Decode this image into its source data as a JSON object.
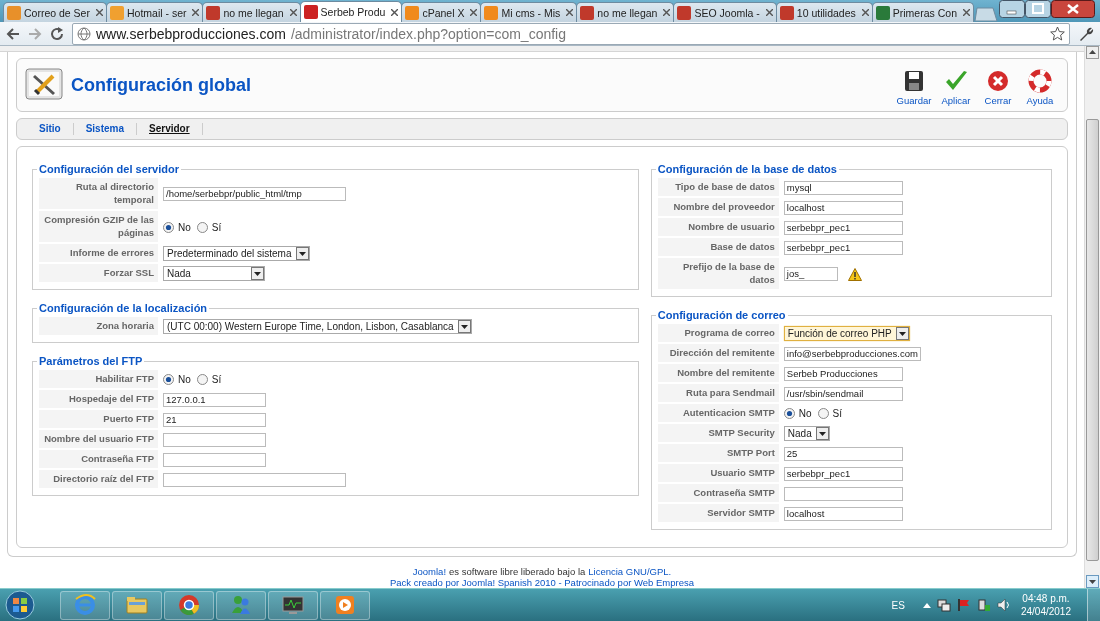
{
  "browser": {
    "tabs": [
      {
        "title": "Correo de Ser",
        "selected": false,
        "color": "#e8902a"
      },
      {
        "title": "Hotmail - ser",
        "selected": false,
        "color": "#f0a030"
      },
      {
        "title": "no me llegan",
        "selected": false,
        "color": "#c0392b"
      },
      {
        "title": "Serbeb Produ",
        "selected": true,
        "color": "#cc2222"
      },
      {
        "title": "cPanel X",
        "selected": false,
        "color": "#f08a1c"
      },
      {
        "title": "Mi cms - Mis",
        "selected": false,
        "color": "#f08a1c"
      },
      {
        "title": "no me llegan",
        "selected": false,
        "color": "#c0392b"
      },
      {
        "title": "SEO Joomla -",
        "selected": false,
        "color": "#c0392b"
      },
      {
        "title": "10 utilidades",
        "selected": false,
        "color": "#c0392b"
      },
      {
        "title": "Primeras Con",
        "selected": false,
        "color": "#2a7a3a"
      }
    ],
    "address": {
      "host": "www.serbebproducciones.com",
      "path": "/administrator/index.php?option=com_config"
    }
  },
  "header": {
    "title": "Configuración global",
    "toolbar": [
      {
        "label": "Guardar",
        "kind": "save"
      },
      {
        "label": "Aplicar",
        "kind": "apply"
      },
      {
        "label": "Cerrar",
        "kind": "close"
      },
      {
        "label": "Ayuda",
        "kind": "help"
      }
    ]
  },
  "submenu": [
    {
      "label": "Sitio",
      "selected": false
    },
    {
      "label": "Sistema",
      "selected": false
    },
    {
      "label": "Servidor",
      "selected": true
    }
  ],
  "left_column": [
    {
      "legend": "Configuración del servidor",
      "rows": [
        {
          "label": "Ruta al directorio temporal",
          "kind": "text",
          "value": "/home/serbebpr/public_html/tmp"
        },
        {
          "label": "Compresión GZIP de las páginas",
          "kind": "radio",
          "options": [
            {
              "label": "No",
              "selected": true
            },
            {
              "label": "Sí",
              "selected": false
            }
          ]
        },
        {
          "label": "Informe de errores",
          "kind": "select",
          "value": "Predeterminado del sistema",
          "focused": false
        },
        {
          "label": "Forzar SSL",
          "kind": "select",
          "value": "Nada",
          "focused": false
        }
      ]
    },
    {
      "legend": "Configuración de la localización",
      "rows": [
        {
          "label": "Zona horaria",
          "kind": "select",
          "value": "(UTC 00:00) Western Europe Time, London, Lisbon, Casablanca",
          "focused": false
        }
      ]
    },
    {
      "legend": "Parámetros del FTP",
      "rows": [
        {
          "label": "Habilitar FTP",
          "kind": "radio",
          "options": [
            {
              "label": "No",
              "selected": true
            },
            {
              "label": "Sí",
              "selected": false
            }
          ]
        },
        {
          "label": "Hospedaje del FTP",
          "kind": "text",
          "value": "127.0.0.1"
        },
        {
          "label": "Puerto FTP",
          "kind": "text",
          "value": "21"
        },
        {
          "label": "Nombre del usuario FTP",
          "kind": "text"
        },
        {
          "label": "Contraseña FTP",
          "kind": "text"
        },
        {
          "label": "Directorio raíz del FTP",
          "kind": "text"
        }
      ]
    }
  ],
  "right_column": [
    {
      "legend": "Configuración de la base de datos",
      "rows": [
        {
          "label": "Tipo de base de datos",
          "kind": "text",
          "value": "mysql"
        },
        {
          "label": "Nombre del proveedor",
          "kind": "text",
          "value": "localhost"
        },
        {
          "label": "Nombre de usuario",
          "kind": "text",
          "value": "serbebpr_pec1"
        },
        {
          "label": "Base de datos",
          "kind": "text",
          "value": "serbebpr_pec1"
        },
        {
          "label": "Prefijo de la base de datos",
          "kind": "text",
          "value": "jos_",
          "warning": true
        }
      ]
    },
    {
      "legend": "Configuración de correo",
      "rows": [
        {
          "label": "Programa de correo",
          "kind": "select",
          "value": "Función de correo PHP",
          "focused": true
        },
        {
          "label": "Dirección del remitente",
          "kind": "text",
          "value": "info@serbebproducciones.com"
        },
        {
          "label": "Nombre del remitente",
          "kind": "text",
          "value": "Serbeb Producciones"
        },
        {
          "label": "Ruta para Sendmail",
          "kind": "text",
          "value": "/usr/sbin/sendmail"
        },
        {
          "label": "Autenticacion SMTP",
          "kind": "radio",
          "options": [
            {
              "label": "No",
              "selected": true
            },
            {
              "label": "Sí",
              "selected": false
            }
          ]
        },
        {
          "label": "SMTP Security",
          "kind": "select",
          "value": "Nada",
          "focused": false
        },
        {
          "label": "SMTP Port",
          "kind": "text",
          "value": "25"
        },
        {
          "label": "Usuario SMTP",
          "kind": "text",
          "value": "serbebpr_pec1"
        },
        {
          "label": "Contraseña SMTP",
          "kind": "text"
        },
        {
          "label": "Servidor SMTP",
          "kind": "text",
          "value": "localhost"
        }
      ]
    }
  ],
  "footer": {
    "lines": [
      [
        {
          "text": "Joomla!",
          "kind": "link"
        },
        {
          "text": "es software libre liberado bajo la",
          "kind": "text"
        },
        {
          "text": "Licencia GNU/GPL.",
          "kind": "link"
        }
      ],
      [
        {
          "text": "Pack creado por Joomla! Spanish 2010 - Patrocinado por Web Empresa",
          "kind": "link"
        }
      ]
    ]
  },
  "taskbar": {
    "apps": [
      {
        "kind": "ie"
      },
      {
        "kind": "folder"
      },
      {
        "kind": "chrome"
      },
      {
        "kind": "messenger"
      },
      {
        "kind": "monitor"
      },
      {
        "kind": "player"
      }
    ],
    "language": "ES",
    "time": "04:48 p.m.",
    "date": "24/04/2012"
  }
}
